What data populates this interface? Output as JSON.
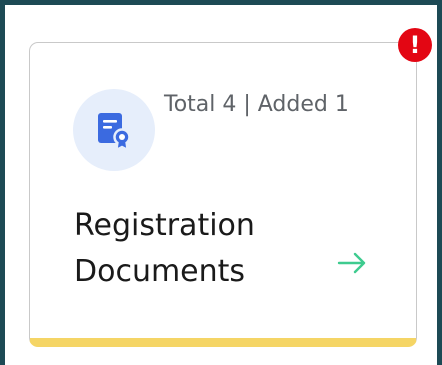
{
  "card": {
    "stats": "Total 4 | Added 1",
    "title": "Registration Documents",
    "icon": "certificate-document-icon",
    "arrow_icon": "arrow-right-icon",
    "accent_color": "#f5d565",
    "arrow_color": "#3ecb8f",
    "icon_color": "#3b6ae0"
  },
  "badge": {
    "symbol": "!",
    "color": "#e30613"
  }
}
